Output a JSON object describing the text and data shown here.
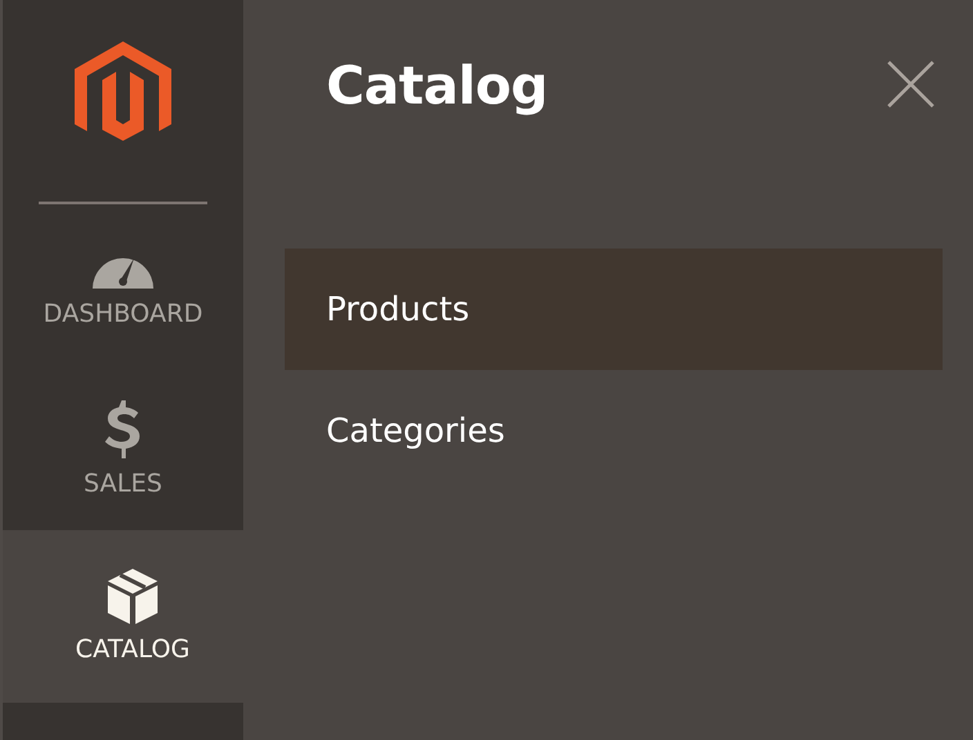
{
  "sidebar": {
    "items": [
      {
        "kind": "dashboard",
        "label": "DASHBOARD",
        "selected": false
      },
      {
        "kind": "sales",
        "label": "SALES",
        "selected": false
      },
      {
        "kind": "catalog",
        "label": "CATALOG",
        "selected": true
      }
    ]
  },
  "panel": {
    "title": "Catalog",
    "items": [
      {
        "label": "Products",
        "selected": true
      },
      {
        "label": "Categories",
        "selected": false
      }
    ]
  }
}
